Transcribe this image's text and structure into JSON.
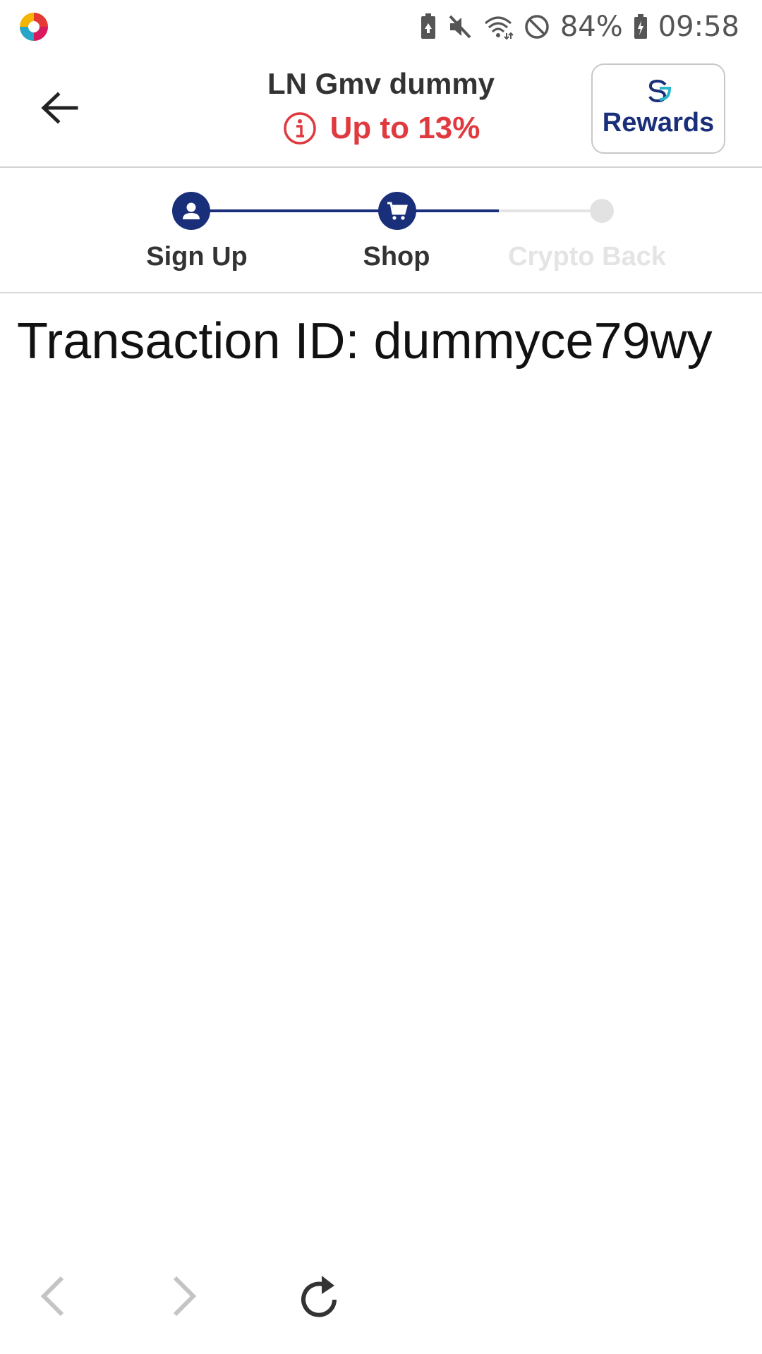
{
  "status_bar": {
    "battery_percent": "84%",
    "time": "09:58",
    "icons": [
      "battery-saver-icon",
      "mute-icon",
      "wifi-icon",
      "do-not-disturb-icon",
      "battery-charging-icon"
    ]
  },
  "header": {
    "title": "LN Gmv dummy",
    "subtitle": "Up to 13%",
    "subtitle_color": "#e0393e",
    "rewards_label": "Rewards",
    "accent_color": "#1a2f7a"
  },
  "stepper": {
    "steps": [
      {
        "label": "Sign Up",
        "state": "complete",
        "icon": "person-icon"
      },
      {
        "label": "Shop",
        "state": "active",
        "icon": "cart-icon"
      },
      {
        "label": "Crypto Back",
        "state": "pending",
        "icon": "dot-icon"
      }
    ]
  },
  "content": {
    "transaction_text": "Transaction ID: dummyce79wy"
  },
  "bottom_nav": {
    "icons": [
      "back-arrow-icon",
      "forward-arrow-icon",
      "refresh-icon"
    ]
  }
}
